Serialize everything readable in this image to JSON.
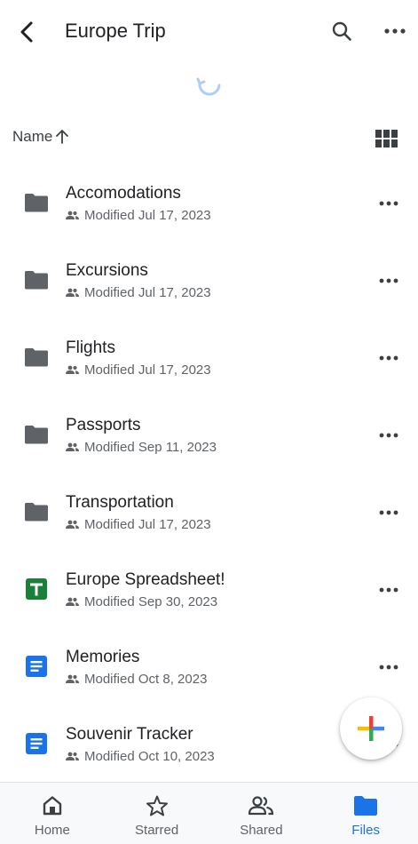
{
  "header": {
    "title": "Europe Trip",
    "back_icon": "arrow-back-icon",
    "search_icon": "search-icon",
    "more_icon": "more-horiz-icon"
  },
  "sort": {
    "label": "Name",
    "direction": "ascending",
    "view_toggle_icon": "grid-view-icon"
  },
  "files": [
    {
      "name": "Accomodations",
      "modified": "Modified Jul 17, 2023",
      "type": "folder",
      "shared": true
    },
    {
      "name": "Excursions",
      "modified": "Modified Jul 17, 2023",
      "type": "folder",
      "shared": true
    },
    {
      "name": "Flights",
      "modified": "Modified Jul 17, 2023",
      "type": "folder",
      "shared": true
    },
    {
      "name": "Passports",
      "modified": "Modified Sep 11, 2023",
      "type": "folder",
      "shared": true
    },
    {
      "name": "Transportation",
      "modified": "Modified Jul 17, 2023",
      "type": "folder",
      "shared": true
    },
    {
      "name": "Europe Spreadsheet!",
      "modified": "Modified Sep 30, 2023",
      "type": "sheet",
      "shared": true
    },
    {
      "name": "Memories",
      "modified": "Modified Oct 8, 2023",
      "type": "doc",
      "shared": true
    },
    {
      "name": "Souvenir Tracker",
      "modified": "Modified Oct 10, 2023",
      "type": "doc",
      "shared": true
    }
  ],
  "fab": {
    "icon": "plus-icon"
  },
  "nav": [
    {
      "label": "Home",
      "icon": "home-icon",
      "active": false
    },
    {
      "label": "Starred",
      "icon": "star-icon",
      "active": false
    },
    {
      "label": "Shared",
      "icon": "people-icon",
      "active": false
    },
    {
      "label": "Files",
      "icon": "folder-icon",
      "active": true
    }
  ],
  "colors": {
    "accent": "#1a73e8",
    "folder": "#5f6368",
    "sheet": "#188038",
    "doc": "#1a73e8"
  }
}
